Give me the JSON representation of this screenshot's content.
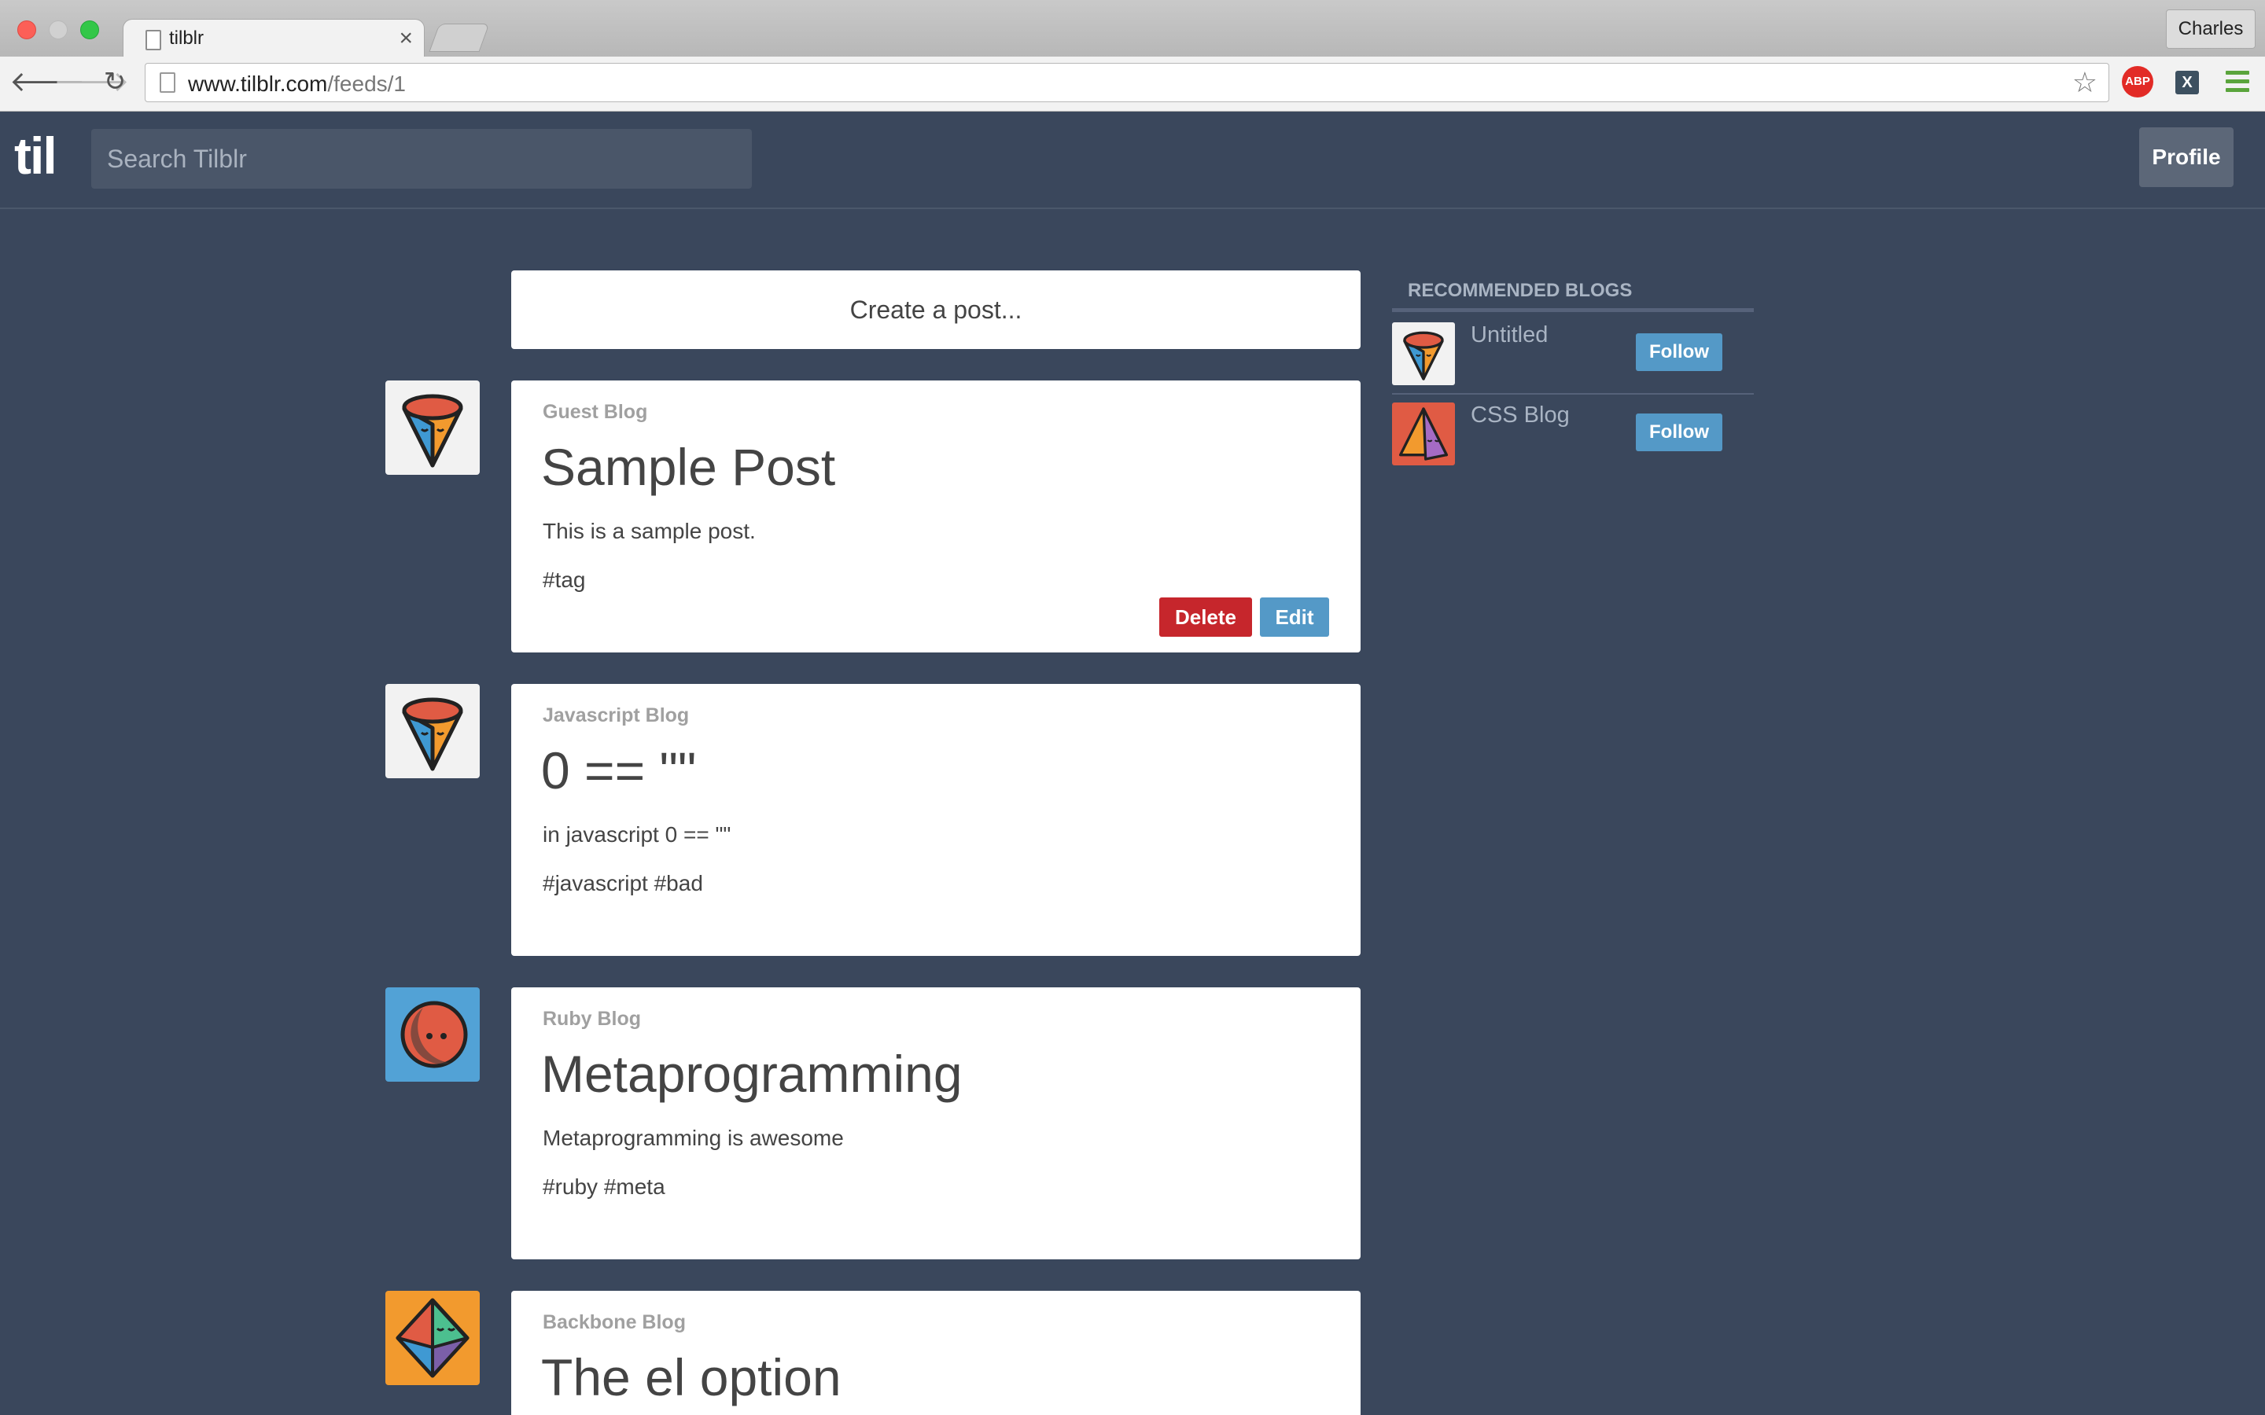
{
  "browser": {
    "tab_title": "tilblr",
    "tab_close": "×",
    "url_host": "www.tilblr.com",
    "url_path": "/feeds/1",
    "profile_name": "Charles",
    "nav_back": "🡐",
    "nav_forward": "🡒",
    "nav_reload": "↻",
    "bookmark_star": "☆",
    "ext_adblock": "ABP",
    "ext_x": "X"
  },
  "header": {
    "logo": "til",
    "search_placeholder": "Search Tilblr",
    "profile_button": "Profile"
  },
  "feed": {
    "create_post": "Create a post...",
    "posts": [
      {
        "blog": "Guest Blog",
        "title": "Sample Post",
        "body": "This is a sample post.",
        "tags": "#tag",
        "avatar_icon": "cone-face-icon",
        "actions": {
          "delete": "Delete",
          "edit": "Edit"
        }
      },
      {
        "blog": "Javascript Blog",
        "title": "0 == \"\"",
        "body": "in javascript 0 == \"\"",
        "tags": "#javascript #bad",
        "avatar_icon": "cone-face-icon"
      },
      {
        "blog": "Ruby Blog",
        "title": "Metaprogramming",
        "body": "Metaprogramming is awesome",
        "tags": "#ruby #meta",
        "avatar_icon": "sphere-face-icon"
      },
      {
        "blog": "Backbone Blog",
        "title": "The el option",
        "avatar_icon": "octahedron-face-icon"
      }
    ]
  },
  "sidebar": {
    "heading": "RECOMMENDED BLOGS",
    "blogs": [
      {
        "name": "Untitled",
        "follow": "Follow",
        "avatar_icon": "cone-face-icon"
      },
      {
        "name": "CSS Blog",
        "follow": "Follow",
        "avatar_icon": "pyramid-face-icon"
      }
    ]
  },
  "colors": {
    "page_background": "#3a475c",
    "delete_button": "#c6262c",
    "edit_button": "#5499c7",
    "follow_button": "#5499c7",
    "card_background": "#ffffff"
  }
}
